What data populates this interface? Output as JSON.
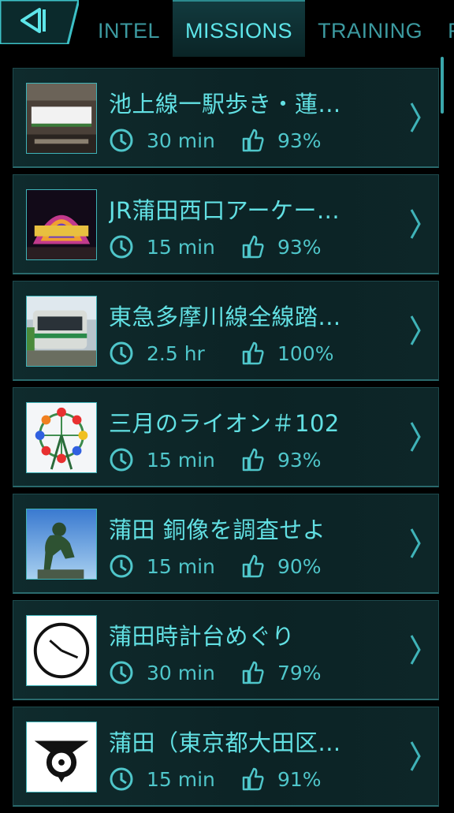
{
  "header": {
    "back_icon": "back-arrow-icon",
    "tabs": [
      {
        "label": "INTEL",
        "active": false
      },
      {
        "label": "MISSIONS",
        "active": true
      },
      {
        "label": "TRAINING",
        "active": false
      },
      {
        "label": "REC",
        "active": false
      }
    ]
  },
  "missions": [
    {
      "title": "池上線一駅歩き・蓮...",
      "duration": "30 min",
      "rating": "93%",
      "thumb": "station-sign-photo"
    },
    {
      "title": "JR蒲田西口アーケー...",
      "duration": "15 min",
      "rating": "93%",
      "thumb": "arcade-sign-photo"
    },
    {
      "title": "東急多摩川線全線踏...",
      "duration": "2.5 hr",
      "rating": "100%",
      "thumb": "train-photo"
    },
    {
      "title": "三月のライオン＃102",
      "duration": "15 min",
      "rating": "93%",
      "thumb": "ferris-wheel-photo"
    },
    {
      "title": "蒲田 銅像を調査せよ",
      "duration": "15 min",
      "rating": "90%",
      "thumb": "thinker-statue-photo"
    },
    {
      "title": "蒲田時計台めぐり",
      "duration": "30 min",
      "rating": "79%",
      "thumb": "clock-face-image"
    },
    {
      "title": "蒲田（東京都大田区...",
      "duration": "15 min",
      "rating": "91%",
      "thumb": "ward-emblem-image"
    }
  ],
  "colors": {
    "accent": "#5ee6ea",
    "card_bg": "#0f2b2d",
    "background": "#000000"
  }
}
